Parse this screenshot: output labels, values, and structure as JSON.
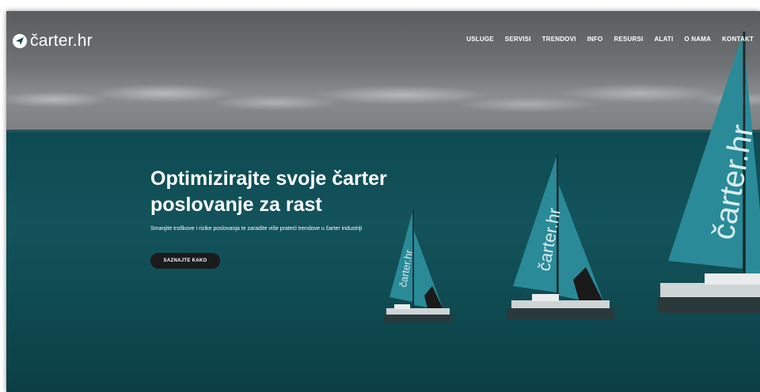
{
  "brand": {
    "name": "čarter.hr"
  },
  "nav": {
    "items": [
      "USLUGE",
      "SERVISI",
      "TRENDOVI",
      "INFO",
      "RESURSI",
      "ALATI",
      "O NAMA",
      "KONTAKT"
    ]
  },
  "hero": {
    "title_line1": "Optimizirajte svoje čarter",
    "title_line2": "poslovanje za rast",
    "subtitle": "Smanjite troškove i rizike poslovanja te zaradite više prateći trendove u čarter industriji",
    "cta_label": "SAZNAJTE KAKO"
  },
  "sail_text": "čarter.hr",
  "colors": {
    "sea": "#13535b",
    "sky": "#6f7274",
    "sail": "#2a8a98",
    "button": "#1b1b1b",
    "text": "#ffffff"
  }
}
